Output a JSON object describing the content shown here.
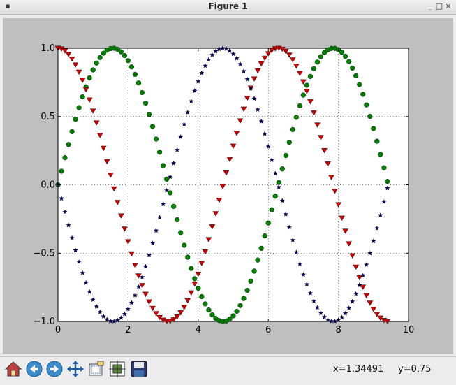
{
  "window": {
    "title": "Figure 1",
    "minimize_glyph": "_",
    "maximize_glyph": "□",
    "close_glyph": "×"
  },
  "toolbar": {
    "buttons": [
      {
        "name": "home-icon"
      },
      {
        "name": "back-arrow-icon"
      },
      {
        "name": "forward-arrow-icon"
      },
      {
        "name": "pan-icon"
      },
      {
        "name": "zoom-rect-icon"
      },
      {
        "name": "subplots-icon"
      },
      {
        "name": "save-icon"
      }
    ],
    "x_readout": "x=1.34491",
    "y_readout": "y=0.75"
  },
  "chart_data": {
    "type": "scatter",
    "title": "",
    "xlabel": "",
    "ylabel": "",
    "xlim": [
      0,
      10
    ],
    "ylim": [
      -1.0,
      1.0
    ],
    "xticks": [
      "0",
      "2",
      "4",
      "6",
      "8",
      "10"
    ],
    "yticks": [
      "−1.0",
      "−0.5",
      "0.0",
      "0.5",
      "1.0"
    ],
    "grid": true,
    "x": {
      "start": 0.0,
      "stop": 9.4,
      "step": 0.1
    },
    "series": [
      {
        "function": "sin(x)",
        "marker": "circle",
        "color": "#007f00"
      },
      {
        "function": "cos(x)",
        "marker": "triangle-down",
        "color": "#cc0000"
      },
      {
        "function": "-sin(x)",
        "marker": "star",
        "color": "#00005f"
      }
    ]
  }
}
